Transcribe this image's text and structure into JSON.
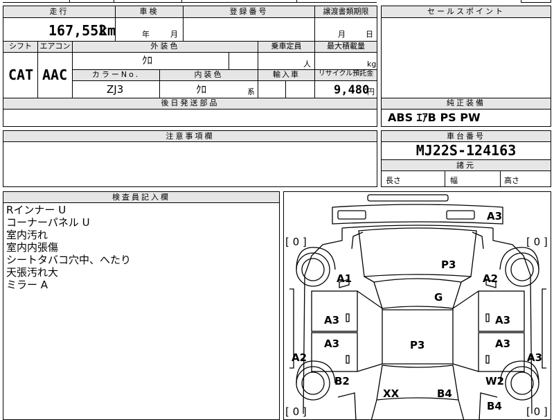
{
  "labels": {
    "mileage": "走行",
    "inspection": "車検",
    "registration": "登録番号",
    "transfer_deadline": "譲渡書類期限",
    "sales_point": "セールスポイント",
    "shift": "シフト",
    "aircon": "エアコン",
    "exterior_color": "外装色",
    "capacity": "乗車定員",
    "max_load": "最大積載量",
    "color_no": "カラーNo.",
    "interior_color": "内装色",
    "import": "輸入車",
    "recycle_fee": "リサイクル預託金",
    "later_parts": "後日発送部品",
    "genuine_equipment": "純正装備",
    "notes": "注意事項欄",
    "chassis_no": "車台番号",
    "dimensions": "諸元",
    "length": "長さ",
    "width": "幅",
    "height": "高さ",
    "inspector_notes": "検査員記入欄"
  },
  "units": {
    "km": "km",
    "year": "年",
    "month": "月",
    "day": "日",
    "person": "人",
    "kg": "kg",
    "kei": "系",
    "yen": "円"
  },
  "values": {
    "mileage": "167,552",
    "shift": "CAT",
    "aircon": "AAC",
    "exterior_color": "ｸﾛ",
    "color_no": "ZJ3",
    "interior_color": "ｸﾛ",
    "recycle_fee": "9,480",
    "genuine_equipment": "ABS ｴｱB PS PW",
    "chassis_no": "MJ22S-124163"
  },
  "inspector_notes": [
    "Rインナー U",
    "コーナーパネル U",
    "室内汚れ",
    "室内内張傷",
    "シートタバコ穴中、へたり",
    "天張汚れ大",
    "ミラー A"
  ],
  "diagram": {
    "tire_bracket": "[ 0 ]",
    "marks": {
      "front_right": "A3",
      "hood": "P3",
      "front_left_fender": "A1",
      "front_right_fender": "A2",
      "windshield": "G",
      "front_left_door": "A3",
      "front_right_door": "A3",
      "rear_left_door": "A3",
      "rear_right_door": "A3",
      "roof": "P3",
      "left_sill": "A2",
      "right_sill": "A3",
      "rear_left_fender": "B2",
      "rear_right_fender": "W2",
      "rear_left": "XX",
      "rear_center": "B4",
      "rear_right": "B4"
    }
  }
}
